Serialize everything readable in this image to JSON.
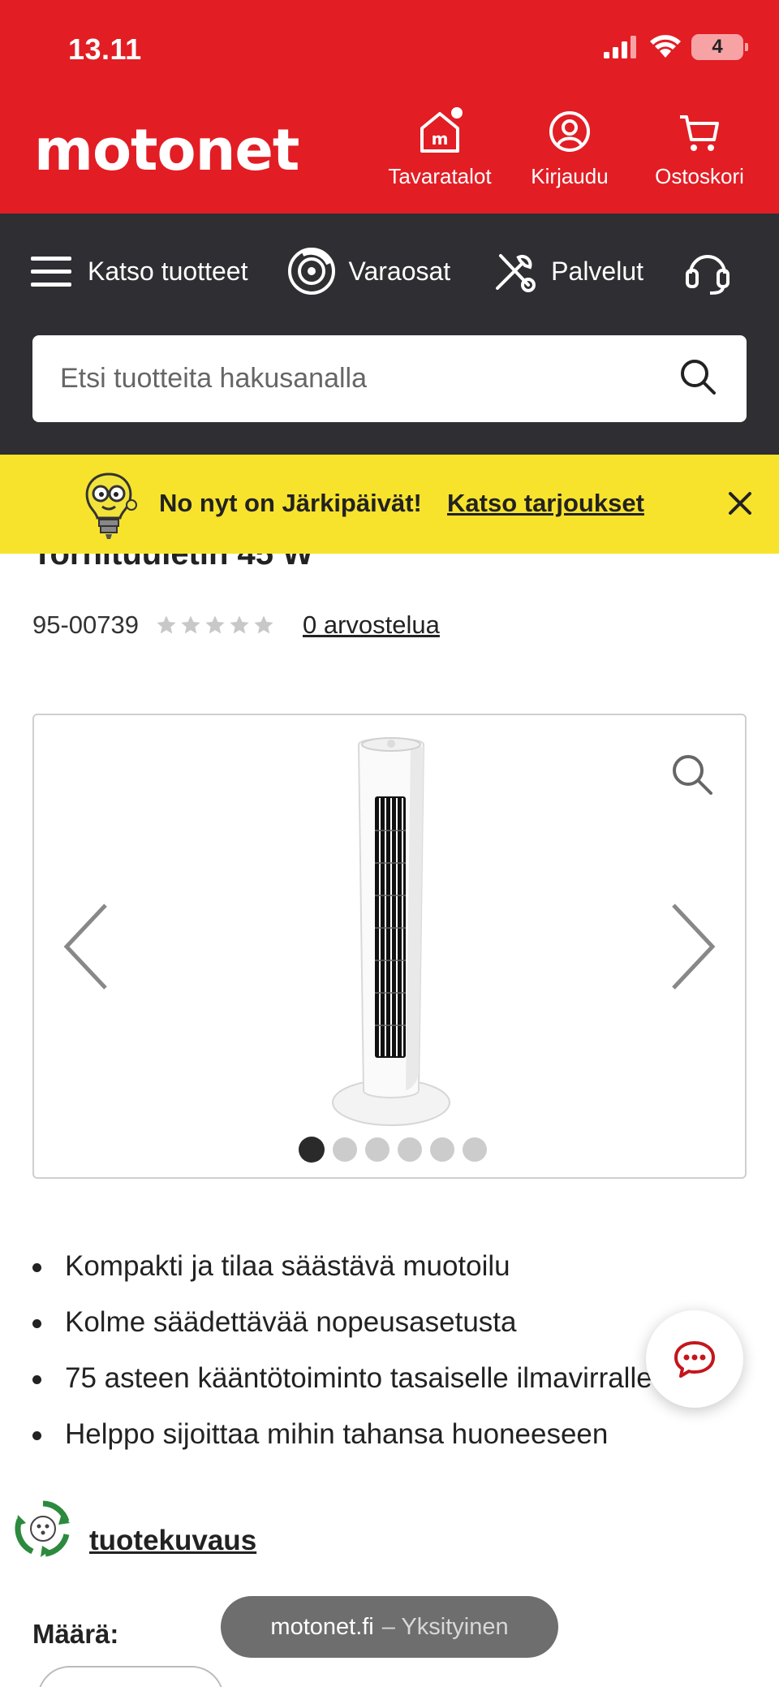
{
  "status_bar": {
    "time": "13.11",
    "battery": "4"
  },
  "header": {
    "logo": "motonet",
    "actions": [
      {
        "label": "Tavaratalot",
        "icon": "store-icon"
      },
      {
        "label": "Kirjaudu",
        "icon": "user-icon"
      },
      {
        "label": "Ostoskori",
        "icon": "cart-icon"
      }
    ]
  },
  "nav": {
    "items": [
      {
        "label": "Katso tuotteet",
        "icon": "menu-icon"
      },
      {
        "label": "Varaosat",
        "icon": "brake-disc-icon"
      },
      {
        "label": "Palvelut",
        "icon": "tools-icon"
      }
    ],
    "support_icon": "headset-icon"
  },
  "search": {
    "placeholder": "Etsi tuotteita hakusanalla"
  },
  "promo": {
    "text": "No nyt on Järkipäivät!",
    "link": "Katso tarjoukset"
  },
  "product": {
    "title": "Tornituuletin 45 W",
    "sku": "95-00739",
    "rating_stars": 0,
    "reviews_link": "0 arvostelua",
    "gallery": {
      "image_count": 6,
      "active_index": 0
    },
    "features": [
      "Kompakti ja tilaa säästävä muotoilu",
      "Kolme säädettävää nopeusasetusta",
      "75 asteen kääntötoiminto tasaiselle ilmavirralle",
      "Helppo sijoittaa mihin tahansa huoneeseen"
    ],
    "description_link": "tuotekuvaus",
    "quantity_label": "Määrä:"
  },
  "browser": {
    "domain": "motonet.fi",
    "mode": "– Yksityinen"
  },
  "colors": {
    "brand_red": "#e21d24",
    "nav_dark": "#2f2f33",
    "promo_yellow": "#f8e32c"
  }
}
